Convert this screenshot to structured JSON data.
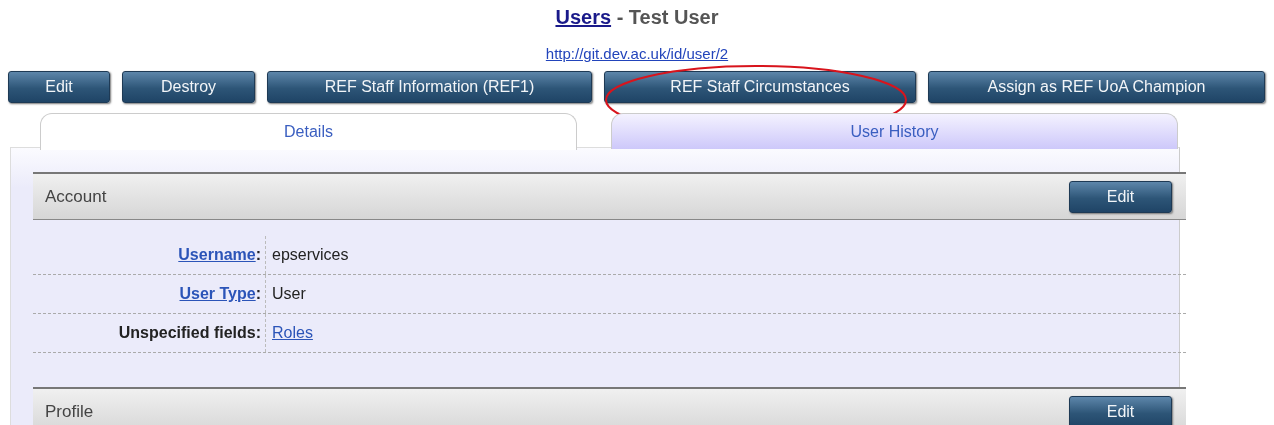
{
  "header": {
    "title_link": "Users",
    "title_rest": " - Test User",
    "url": "http://git.dev.ac.uk/id/user/2"
  },
  "actions": [
    "Edit",
    "Destroy",
    "REF Staff Information (REF1)",
    "REF Staff Circumstances",
    "Assign as REF UoA Champion"
  ],
  "tabs": [
    {
      "label": "Details",
      "selected": true
    },
    {
      "label": "User History",
      "selected": false
    }
  ],
  "sections": [
    {
      "title": "Account",
      "button": "Edit",
      "rows": [
        {
          "label": "Username",
          "suffix": ":",
          "label_link": true,
          "value": "epservices",
          "value_link": false
        },
        {
          "label": "User Type",
          "suffix": ":",
          "label_link": true,
          "value": "User",
          "value_link": false
        },
        {
          "label": "Unspecified fields",
          "suffix": ":",
          "label_link": false,
          "value": "Roles",
          "value_link": true
        }
      ]
    },
    {
      "title": "Profile",
      "button": "Edit"
    }
  ]
}
